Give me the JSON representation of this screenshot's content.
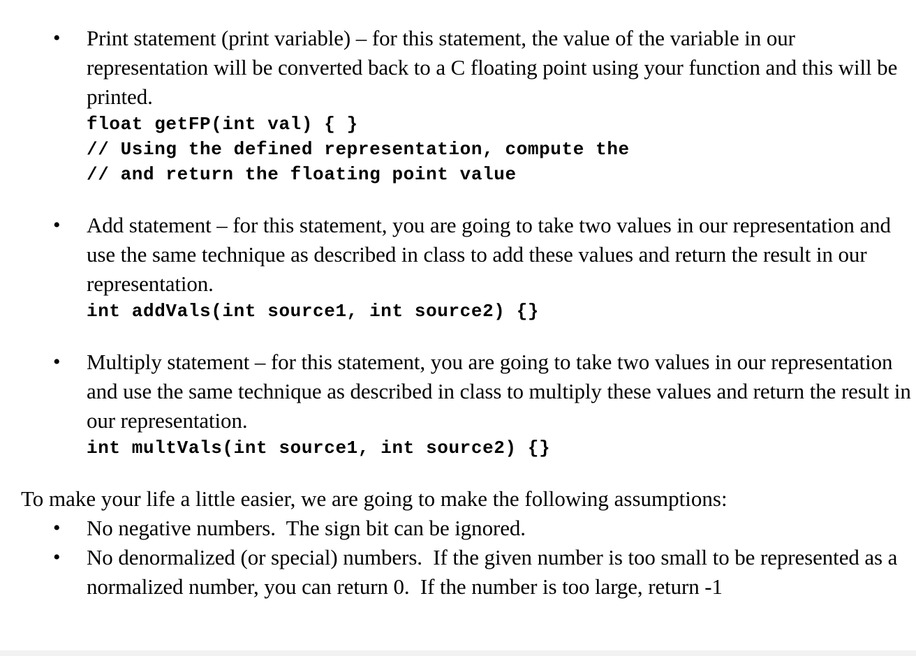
{
  "document": {
    "background_color": "#ffffff",
    "text_color": "#000000",
    "bullet_glyph": "•"
  },
  "statements": {
    "items": [
      {
        "id": "print-statement",
        "prose": "Print statement (print variable) – for this statement, the value of the variable in our representation will be converted back to a C floating point using your function and this will be printed.",
        "code": [
          "float getFP(int val) { }",
          "// Using the defined representation, compute the",
          "// and return the floating point value"
        ]
      },
      {
        "id": "add-statement",
        "prose": "Add statement – for this statement, you are going to take two values in our representation and use the same technique as described in class to add these values and return the result in our representation.",
        "code": [
          "int addVals(int source1, int source2) {}"
        ]
      },
      {
        "id": "multiply-statement",
        "prose": "Multiply statement – for this statement, you are going to take two values in our representation and use the same technique as described in class to multiply these values and return the result in our representation.",
        "code": [
          "int multVals(int source1, int source2) {}"
        ]
      }
    ]
  },
  "assumptions": {
    "intro": "To make your life a little easier, we are going to make the following assumptions:",
    "items": [
      {
        "id": "no-negative-numbers",
        "text": "No negative numbers.  The sign bit can be ignored."
      },
      {
        "id": "no-denormalized-numbers",
        "text": "No denormalized (or special) numbers.  If the given number is too small to be represented as a normalized number, you can return 0.  If the number is too large, return -1"
      }
    ]
  }
}
